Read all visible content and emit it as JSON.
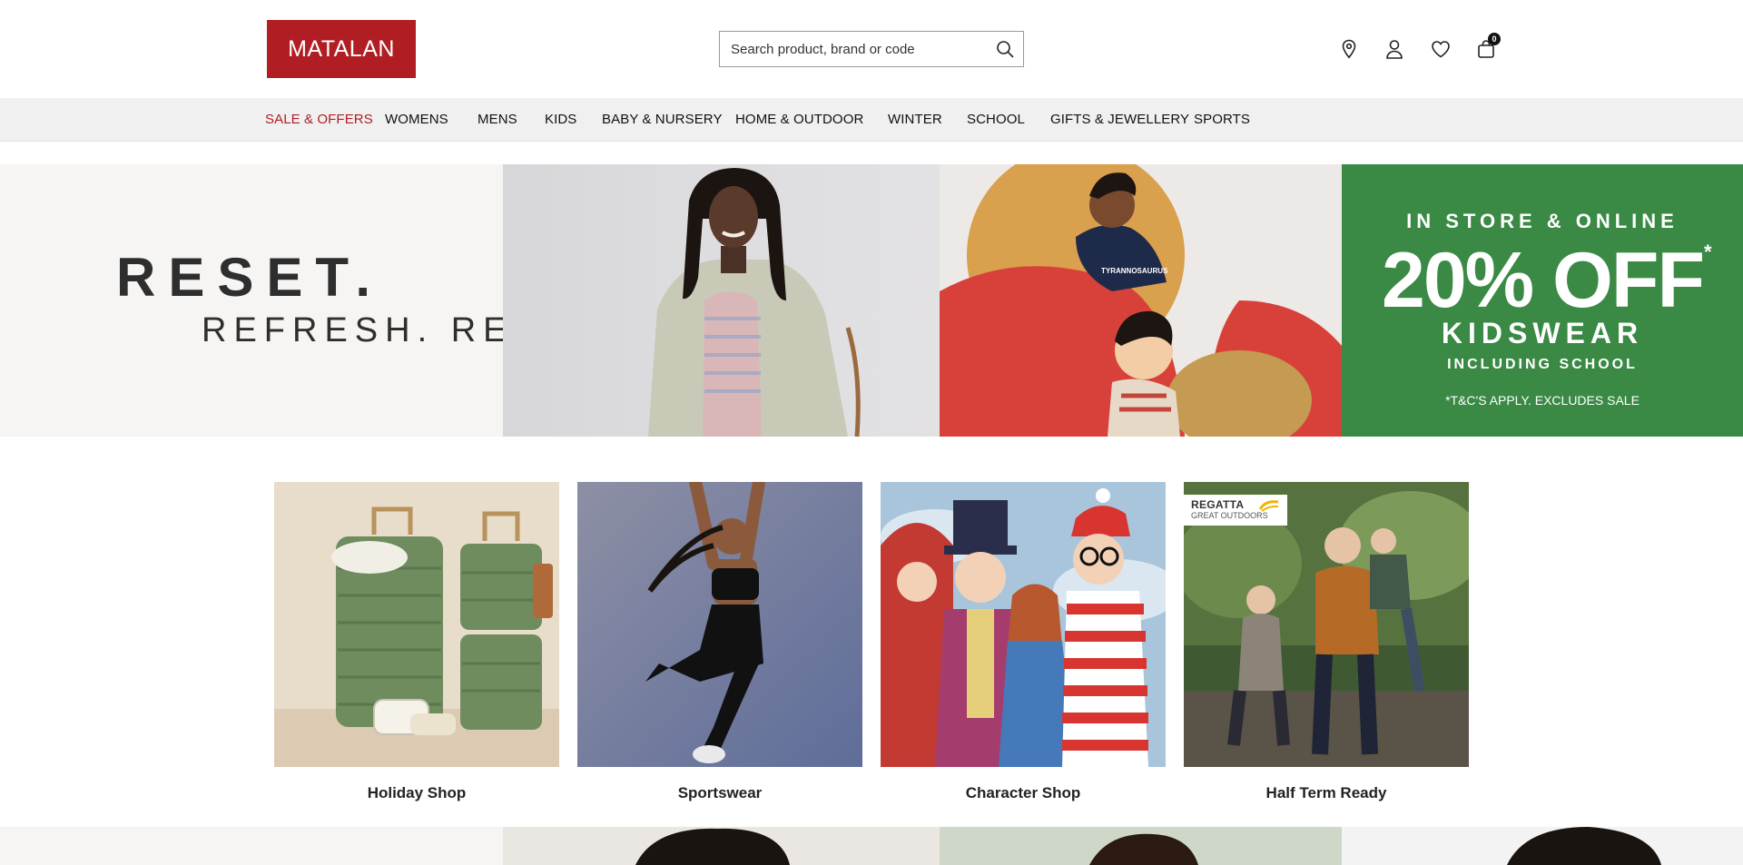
{
  "header": {
    "logo_text": "MATALAN",
    "search_placeholder": "Search product, brand or code",
    "icons": [
      "location-pin-icon",
      "account-icon",
      "wishlist-heart-icon",
      "bag-icon"
    ],
    "cart_count": "0"
  },
  "nav": {
    "items": [
      {
        "label": "SALE & OFFERS"
      },
      {
        "label": "WOMENS"
      },
      {
        "label": "MENS"
      },
      {
        "label": "KIDS"
      },
      {
        "label": "BABY & NURSERY"
      },
      {
        "label": "HOME & OUTDOOR"
      },
      {
        "label": "WINTER"
      },
      {
        "label": "SCHOOL"
      },
      {
        "label": "GIFTS & JEWELLERY"
      },
      {
        "label": "SPORTS"
      }
    ]
  },
  "hero": {
    "headline": "RESET.",
    "subheadline": "REFRESH. REVIVE.",
    "promo": {
      "line1": "IN STORE & ONLINE",
      "line2": "20% OFF",
      "asterisk": "*",
      "line3": "KIDSWEAR",
      "line4": "INCLUDING SCHOOL",
      "terms": "*T&C'S APPLY. EXCLUDES SALE"
    },
    "kid_tshirt_text": "TYRANNOSAURUS"
  },
  "categories": [
    {
      "label": "Holiday Shop"
    },
    {
      "label": "Sportswear"
    },
    {
      "label": "Character Shop"
    },
    {
      "label": "Half Term Ready",
      "badge_line1": "REGATTA",
      "badge_line2": "GREAT OUTDOORS"
    }
  ],
  "colors": {
    "brand_red": "#b01e24",
    "promo_green": "#3a8a45",
    "nav_bg": "#f0f0f0"
  }
}
